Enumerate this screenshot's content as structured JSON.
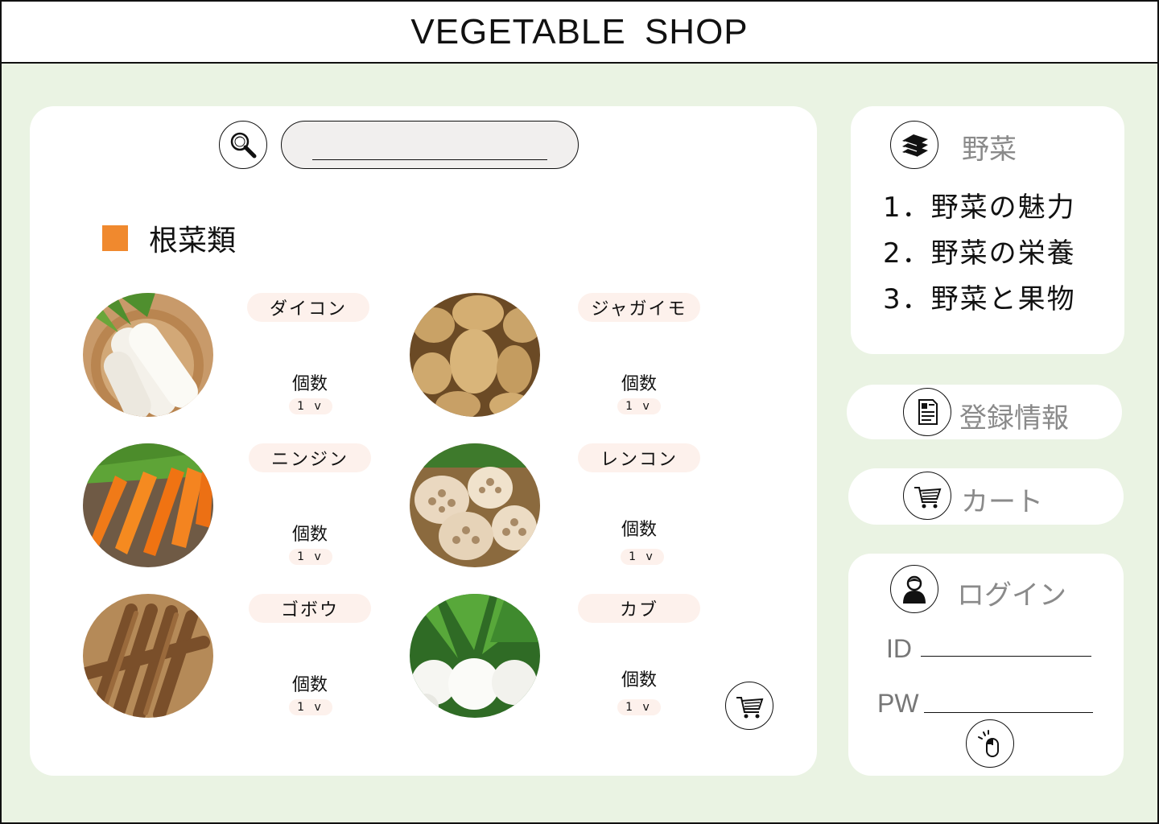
{
  "header": {
    "title": "VEGETABLE SHOP"
  },
  "search": {
    "value": "",
    "placeholder": ""
  },
  "category": {
    "label": "根菜類"
  },
  "products": [
    {
      "name": "ダイコン",
      "qty_label": "個数",
      "qty": "1 v"
    },
    {
      "name": "ジャガイモ",
      "qty_label": "個数",
      "qty": "1 v"
    },
    {
      "name": "ニンジン",
      "qty_label": "個数",
      "qty": "1 v"
    },
    {
      "name": "レンコン",
      "qty_label": "個数",
      "qty": "1 v"
    },
    {
      "name": "ゴボウ",
      "qty_label": "個数",
      "qty": "1 v"
    },
    {
      "name": "カブ",
      "qty_label": "個数",
      "qty": "1 v"
    }
  ],
  "sidebar": {
    "vegetables": {
      "title": "野菜",
      "items": [
        "1．野菜の魅力",
        "2．野菜の栄養",
        "3．野菜と果物"
      ]
    },
    "registration": {
      "label": "登録情報"
    },
    "cart": {
      "label": "カート"
    },
    "login": {
      "title": "ログイン",
      "id_label": "ID",
      "pw_label": "PW",
      "id_value": "",
      "pw_value": ""
    }
  },
  "colors": {
    "accent": "#f0892e",
    "background": "#eaf3e3",
    "pill": "#fdf1ec"
  },
  "icons": [
    "search-icon",
    "book-icon",
    "document-icon",
    "cart-icon",
    "user-icon",
    "mouse-click-icon"
  ]
}
